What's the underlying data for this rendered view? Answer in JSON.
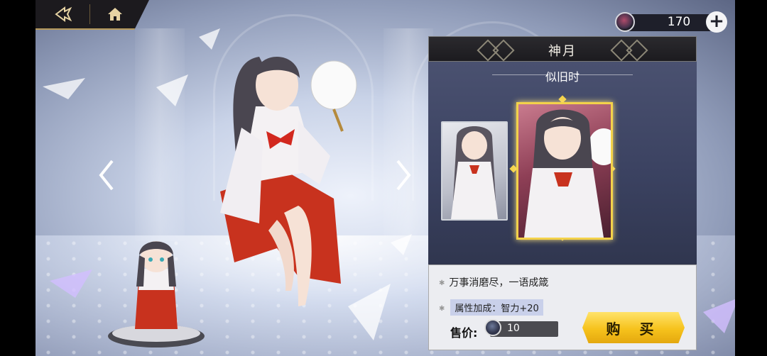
{
  "currency": {
    "amount": "170"
  },
  "panel": {
    "character_name": "神月",
    "skin_name": "似旧时",
    "description": "万事消磨尽，一语成箴",
    "attribute": "属性加成：智力+20",
    "price_label": "售价:",
    "price": "10",
    "buy_label": "购 买"
  },
  "icons": {
    "back": "back-arrow-icon",
    "home": "home-icon",
    "left": "chevron-left-icon",
    "right": "chevron-right-icon",
    "gem": "gem-icon",
    "add": "plus-icon"
  },
  "colors": {
    "accent_gold": "#f3d24a",
    "panel_dark": "#1c1b1f"
  }
}
